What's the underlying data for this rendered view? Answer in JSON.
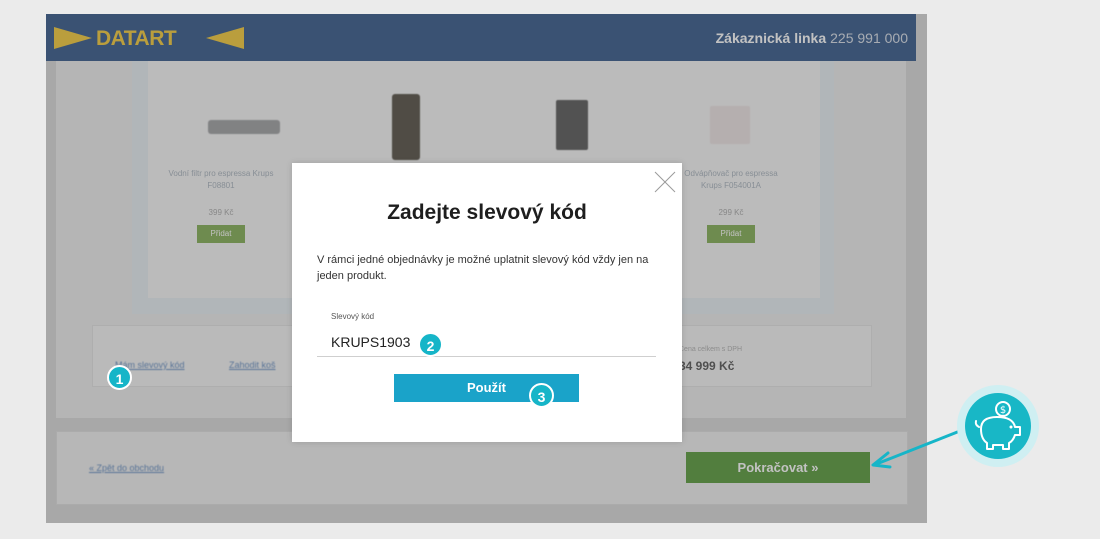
{
  "header": {
    "logo_text": "DATART",
    "hotline_label": "Zákaznická linka",
    "hotline_number": "225 991 000"
  },
  "products": [
    {
      "name": "Vodní filtr pro espressa Krups F08801",
      "price": "399 Kč",
      "add_label": "Přidat"
    },
    {
      "name": "Odvápňovač pro espressa Krups F054001A",
      "price": "299 Kč",
      "add_label": "Přidat"
    }
  ],
  "summary": {
    "discount_link": "Mám slevový kód",
    "discard_link": "Zahodit koš",
    "total_label": "Cena celkem s DPH",
    "total_value": "34 999 Kč"
  },
  "footer": {
    "back_link": "« Zpět do obchodu",
    "continue_label": "Pokračovat »"
  },
  "modal": {
    "title": "Zadejte slevový kód",
    "text": "V rámci jedné objednávky je možné uplatnit slevový kód vždy jen na jeden produkt.",
    "field_label": "Slevový kód",
    "field_value": "KRUPS1903",
    "apply_label": "Použít"
  },
  "steps": [
    "1",
    "2",
    "3"
  ],
  "colors": {
    "header_bg": "#153f78",
    "logo_yellow": "#f2c21b",
    "apply_button": "#1aa3c9",
    "continue_button": "#3f8a1c",
    "badge": "#16b5c8"
  },
  "icons": [
    "close-icon",
    "piggy-bank-icon",
    "arrow-icon"
  ]
}
